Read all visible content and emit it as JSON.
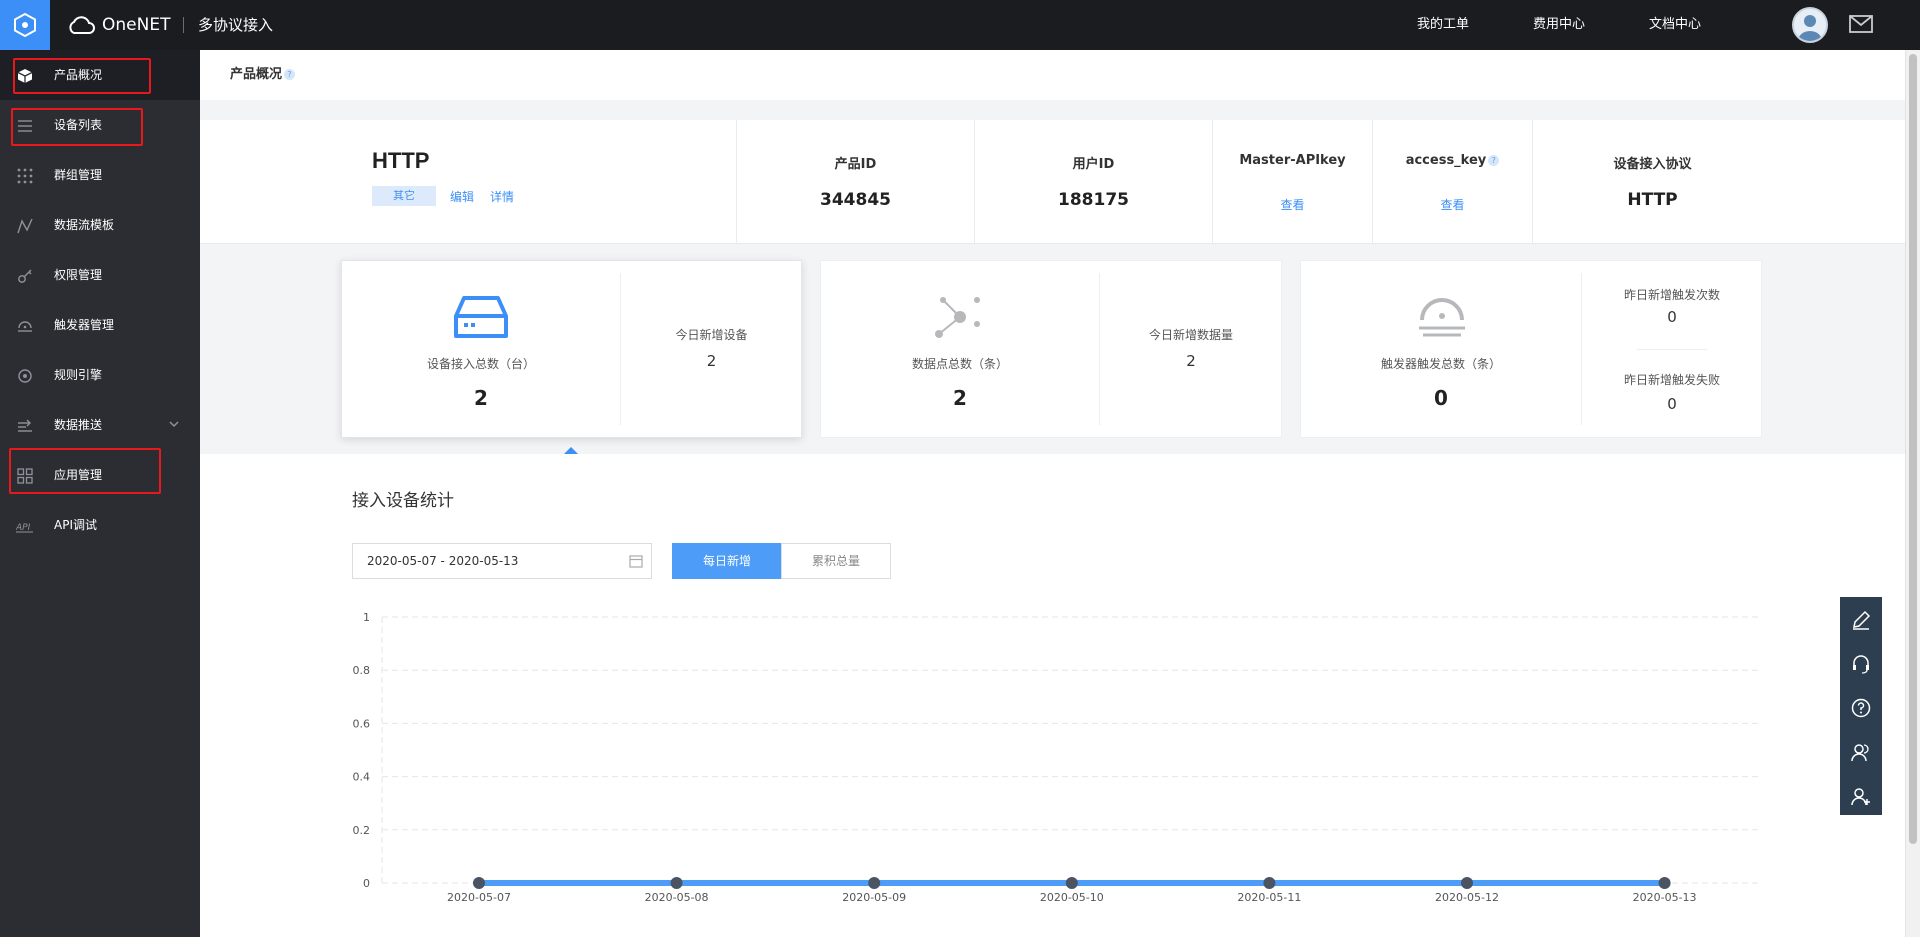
{
  "topbar": {
    "brand": "OneNET",
    "subtitle": "多协议接入",
    "nav": [
      "我的工单",
      "费用中心",
      "文档中心"
    ]
  },
  "sidebar": {
    "items": [
      {
        "label": "产品概况",
        "icon": "box-icon",
        "active": true,
        "highlighted": true
      },
      {
        "label": "设备列表",
        "icon": "list-icon",
        "highlighted": true
      },
      {
        "label": "群组管理",
        "icon": "grid-dots-icon"
      },
      {
        "label": "数据流模板",
        "icon": "dataflow-icon"
      },
      {
        "label": "权限管理",
        "icon": "key-icon"
      },
      {
        "label": "触发器管理",
        "icon": "trigger-icon"
      },
      {
        "label": "规则引擎",
        "icon": "rule-engine-icon"
      },
      {
        "label": "数据推送",
        "icon": "push-icon",
        "expandable": true
      },
      {
        "label": "应用管理",
        "icon": "apps-icon",
        "highlighted": true
      },
      {
        "label": "API调试",
        "icon": "api-icon"
      }
    ]
  },
  "page": {
    "title": "产品概况",
    "help": "?"
  },
  "product": {
    "name": "HTTP",
    "tag": "其它",
    "edit": "编辑",
    "detail": "详情",
    "fields": [
      {
        "label": "产品ID",
        "value": "344845"
      },
      {
        "label": "用户ID",
        "value": "188175"
      },
      {
        "label": "Master-APIkey",
        "action": "查看"
      },
      {
        "label": "access_key",
        "action": "查看",
        "help": "?"
      },
      {
        "label": "设备接入协议",
        "value": "HTTP"
      }
    ]
  },
  "cards": [
    {
      "label": "设备接入总数（台）",
      "value": "2",
      "icon": "device-box-icon",
      "side": [
        {
          "label": "今日新增设备",
          "value": "2"
        }
      ]
    },
    {
      "label": "数据点总数（条）",
      "value": "2",
      "icon": "datapoint-icon",
      "side": [
        {
          "label": "今日新增数据量",
          "value": "2"
        }
      ]
    },
    {
      "label": "触发器触发总数（条）",
      "value": "0",
      "icon": "trigger-bell-icon",
      "side": [
        {
          "label": "昨日新增触发次数",
          "value": "0"
        },
        {
          "label": "昨日新增触发失败",
          "value": "0"
        }
      ]
    }
  ],
  "stats": {
    "title": "接入设备统计",
    "date_range": "2020-05-07 - 2020-05-13",
    "tabs": [
      "每日新增",
      "累积总量"
    ],
    "active_tab": 0
  },
  "chart_data": {
    "type": "line",
    "x": [
      "2020-05-07",
      "2020-05-08",
      "2020-05-09",
      "2020-05-10",
      "2020-05-11",
      "2020-05-12",
      "2020-05-13"
    ],
    "values": [
      0,
      0,
      0,
      0,
      0,
      0,
      0
    ],
    "yticks": [
      "0",
      "0.2",
      "0.4",
      "0.6",
      "0.8",
      "1"
    ],
    "ylim": [
      0,
      1
    ],
    "grid": true,
    "line_color": "#4d9cf8",
    "point_color": "#4a5462"
  },
  "colors": {
    "accent": "#3b8ff6",
    "sidebar_bg": "#2c2d33",
    "topbar_bg": "#1b1c20",
    "highlight_box": "#e8191c"
  },
  "floatbar": [
    "edit-icon",
    "headset-icon",
    "help-icon",
    "group-icon",
    "add-user-icon"
  ]
}
